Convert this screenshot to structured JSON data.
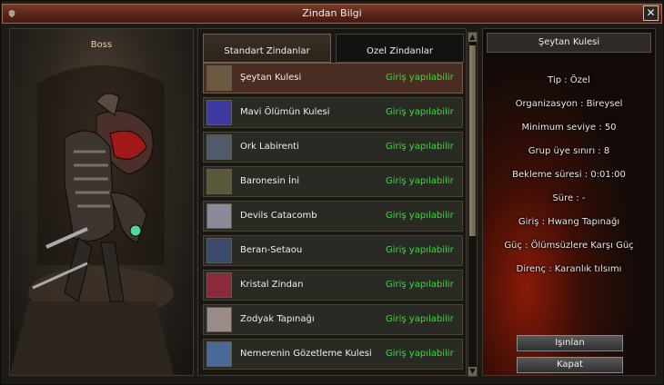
{
  "window": {
    "title": "Zindan Bilgi",
    "close_label": "✕"
  },
  "boss": {
    "label": "Boss"
  },
  "tabs": [
    {
      "label": "Standart Zindanlar",
      "active": true
    },
    {
      "label": "Ozel Zindanlar",
      "active": false
    }
  ],
  "dungeons": [
    {
      "name": "Şeytan Kulesi",
      "status": "Giriş yapılabilir",
      "thumb_color": "#6a5a40",
      "selected": true
    },
    {
      "name": "Mavi Ölümün Kulesi",
      "status": "Giriş yapılabilir",
      "thumb_color": "#3a3aa0"
    },
    {
      "name": "Ork Labirenti",
      "status": "Giriş yapılabilir",
      "thumb_color": "#505a6a"
    },
    {
      "name": "Baronesin İni",
      "status": "Giriş yapılabilir",
      "thumb_color": "#5a5a3a"
    },
    {
      "name": "Devils Catacomb",
      "status": "Giriş yapılabilir",
      "thumb_color": "#8a8a9a"
    },
    {
      "name": "Beran-Setaou",
      "status": "Giriş yapılabilir",
      "thumb_color": "#3a4a6a"
    },
    {
      "name": "Kristal Zindan",
      "status": "Giriş yapılabilir",
      "thumb_color": "#8a2a3a"
    },
    {
      "name": "Zodyak Tapınağı",
      "status": "Giriş yapılabilir",
      "thumb_color": "#9a8a8a"
    },
    {
      "name": "Nemerenin Gözetleme Kulesi",
      "status": "Giriş yapılabilir",
      "thumb_color": "#4a6a9a"
    }
  ],
  "info": {
    "title": "Şeytan Kulesi",
    "lines": [
      "Tip : Özel",
      "Organizasyon : Bireysel",
      "Minimum seviye : 50",
      "Grup üye sınırı : 8",
      "Bekleme süresi : 0:01:00",
      "Süre : -",
      "Giriş : Hwang Tapınağı",
      "Güç : Ölümsüzlere Karşı Güç",
      "Direnç : Karanlık tılsımı"
    ],
    "teleport_label": "Işınlan",
    "close_label": "Kapat"
  },
  "colors": {
    "status_green": "#2ee22e",
    "boss_label": "#f2d38a",
    "title_bar": "#5a2519"
  }
}
